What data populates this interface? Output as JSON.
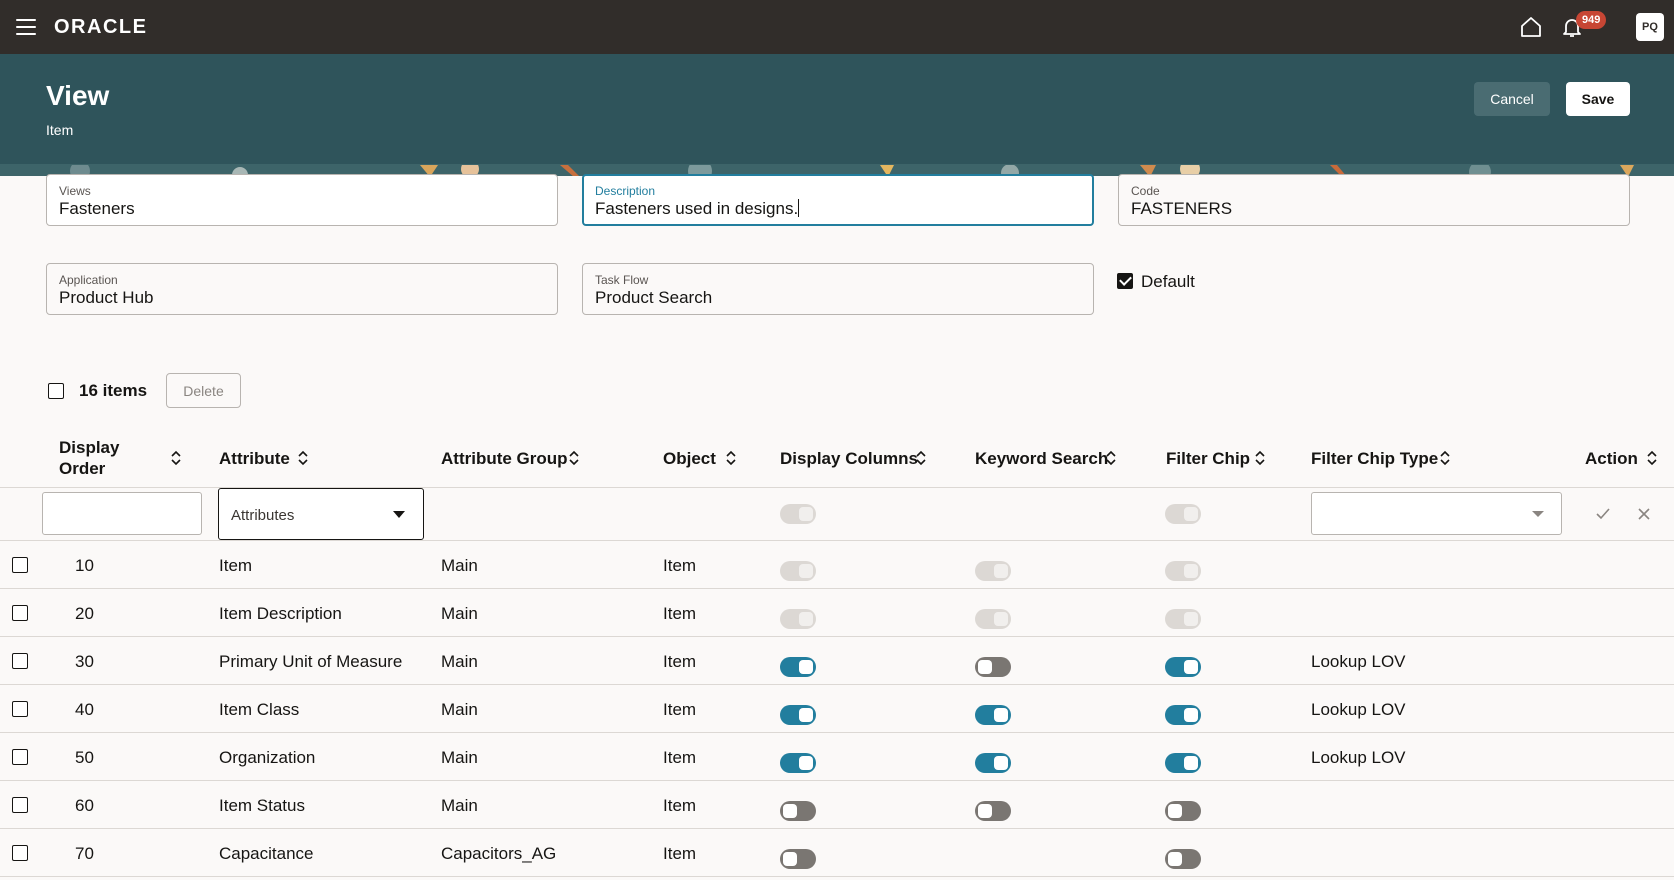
{
  "app": {
    "brand": "ORACLE",
    "notification_count": "949",
    "user_initials": "PQ"
  },
  "header": {
    "title": "View",
    "subtitle": "Item",
    "cancel_label": "Cancel",
    "save_label": "Save"
  },
  "form": {
    "views": {
      "label": "Views",
      "value": "Fasteners"
    },
    "description": {
      "label": "Description",
      "value": "Fasteners used in designs."
    },
    "code": {
      "label": "Code",
      "value": "FASTENERS"
    },
    "application": {
      "label": "Application",
      "value": "Product Hub"
    },
    "task_flow": {
      "label": "Task Flow",
      "value": "Product Search"
    },
    "default": {
      "label": "Default",
      "checked": true
    }
  },
  "table": {
    "count_label": "16 items",
    "delete_label": "Delete",
    "columns": [
      "Display Order",
      "Attribute",
      "Attribute Group",
      "Object",
      "Display Columns",
      "Keyword Search",
      "Filter Chip",
      "Filter Chip Type",
      "Action"
    ],
    "filter": {
      "attribute_placeholder": "Attributes"
    },
    "rows": [
      {
        "order": "10",
        "attribute": "Item",
        "group": "Main",
        "object": "Item",
        "display": "disabled",
        "keyword": "disabled",
        "chip": "disabled",
        "chip_type": ""
      },
      {
        "order": "20",
        "attribute": "Item Description",
        "group": "Main",
        "object": "Item",
        "display": "disabled",
        "keyword": "disabled",
        "chip": "disabled",
        "chip_type": ""
      },
      {
        "order": "30",
        "attribute": "Primary Unit of Measure",
        "group": "Main",
        "object": "Item",
        "display": "on",
        "keyword": "off",
        "chip": "on",
        "chip_type": "Lookup LOV"
      },
      {
        "order": "40",
        "attribute": "Item Class",
        "group": "Main",
        "object": "Item",
        "display": "on",
        "keyword": "on",
        "chip": "on",
        "chip_type": "Lookup LOV"
      },
      {
        "order": "50",
        "attribute": "Organization",
        "group": "Main",
        "object": "Item",
        "display": "on",
        "keyword": "on",
        "chip": "on",
        "chip_type": "Lookup LOV"
      },
      {
        "order": "60",
        "attribute": "Item Status",
        "group": "Main",
        "object": "Item",
        "display": "off",
        "keyword": "off",
        "chip": "off",
        "chip_type": ""
      },
      {
        "order": "70",
        "attribute": "Capacitance",
        "group": "Capacitors_AG",
        "object": "Item",
        "display": "off",
        "keyword": "",
        "chip": "off",
        "chip_type": ""
      }
    ]
  },
  "colors": {
    "topbar": "#312d2a",
    "header": "#2f545b",
    "toggle_on": "#227e9e",
    "badge": "#c74634"
  }
}
